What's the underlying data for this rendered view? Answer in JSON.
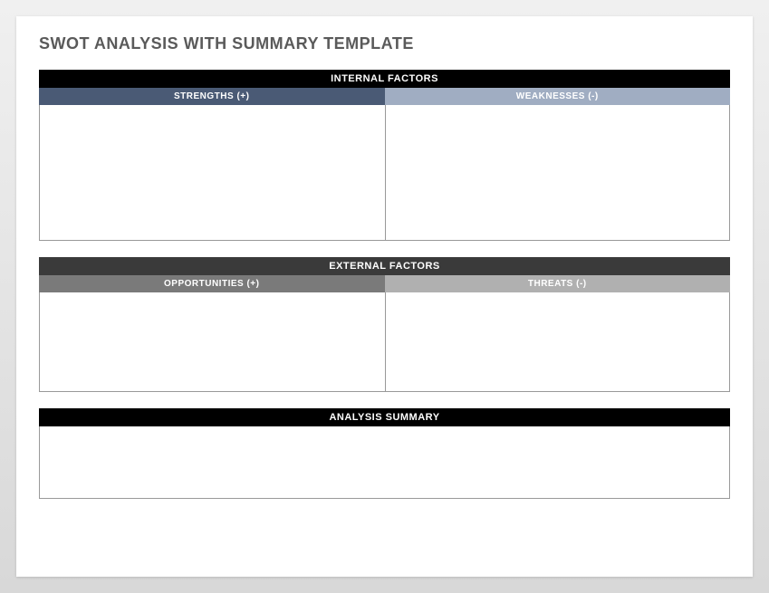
{
  "title": "SWOT ANALYSIS WITH SUMMARY TEMPLATE",
  "sections": {
    "internal": {
      "header": "INTERNAL FACTORS",
      "strengths_label": "STRENGTHS (+)",
      "weaknesses_label": "WEAKNESSES (-)"
    },
    "external": {
      "header": "EXTERNAL FACTORS",
      "opportunities_label": "OPPORTUNITIES (+)",
      "threats_label": "THREATS (-)"
    },
    "summary": {
      "header": "ANALYSIS SUMMARY"
    }
  }
}
